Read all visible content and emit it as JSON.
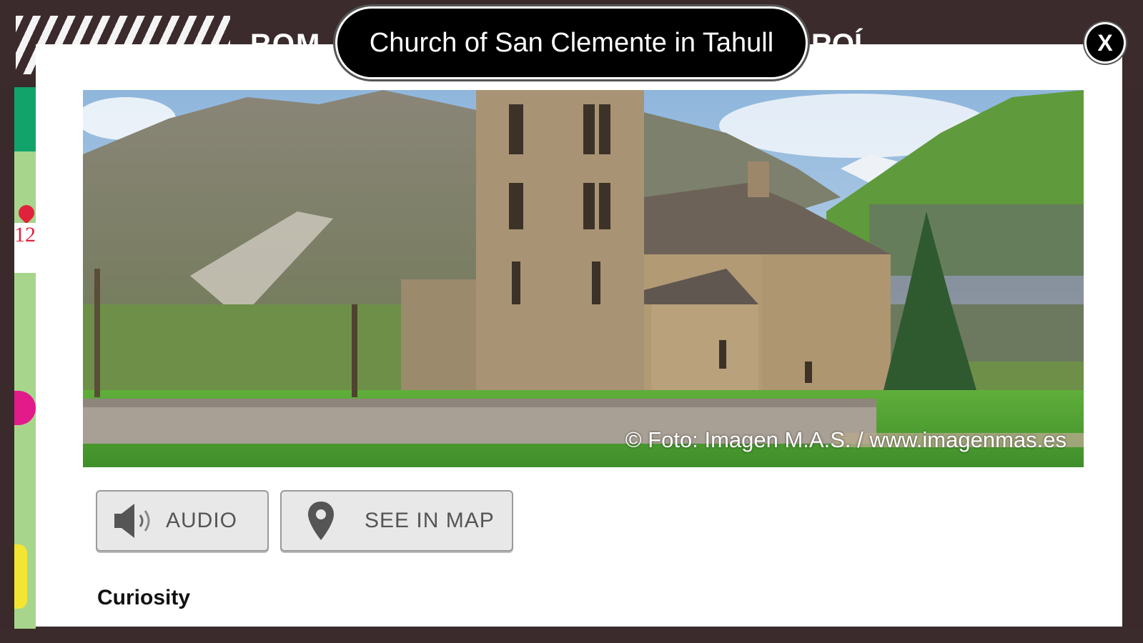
{
  "modal": {
    "title": "Church of San Clemente in Tahull",
    "close_label": "X"
  },
  "photo": {
    "credit": "© Foto: Imagen M.A.S. / www.imagenmas.es"
  },
  "actions": {
    "audio_label": "AUDIO",
    "map_label": "SEE IN MAP"
  },
  "content": {
    "section_heading": "Curiosity"
  },
  "background_page": {
    "header_text_left": "ROM",
    "header_text_right": "ROÍ",
    "marker_number": "12"
  },
  "colors": {
    "header_bg": "#3b2b2d",
    "modal_bg": "#ffffff",
    "title_pill_bg": "#000000",
    "button_bg": "#e8e8e8",
    "side_strip_green": "#a7d58c",
    "marker_red": "#e0233d"
  }
}
